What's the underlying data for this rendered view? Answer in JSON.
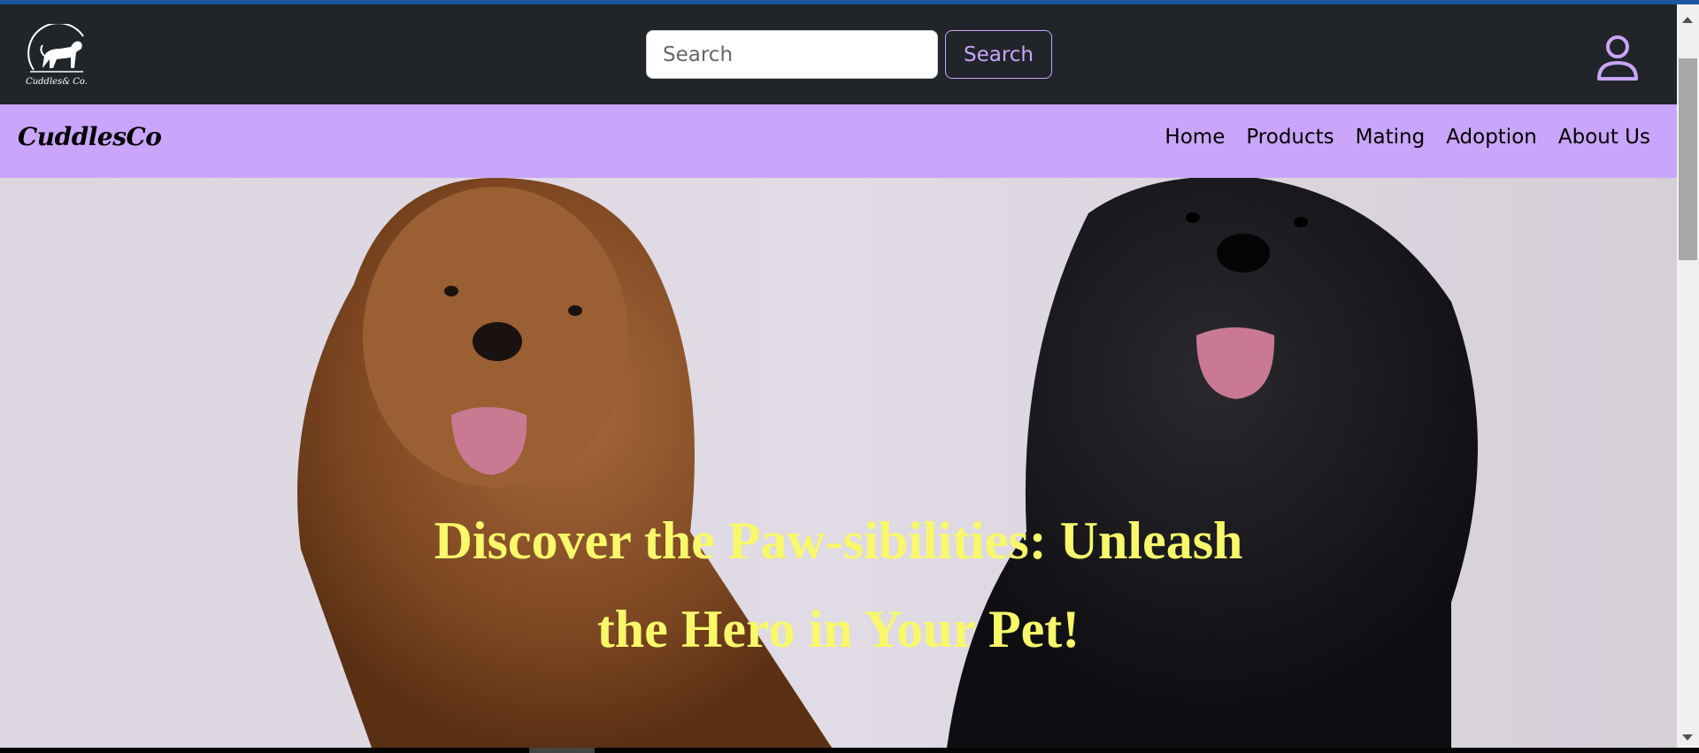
{
  "header": {
    "logo_text": "Cuddles& Co.",
    "search": {
      "placeholder": "Search",
      "value": ""
    },
    "search_button": "Search",
    "user_icon": "user-icon"
  },
  "nav": {
    "brand": "CuddlesCo",
    "links": [
      {
        "label": "Home"
      },
      {
        "label": "Products"
      },
      {
        "label": "Mating"
      },
      {
        "label": "Adoption"
      },
      {
        "label": "About Us"
      }
    ]
  },
  "hero": {
    "headline_line1": "Discover the Paw-sibilities: Unleash",
    "headline_line2": "the Hero in Your Pet!"
  },
  "colors": {
    "header_bg": "#212529",
    "nav_bg": "#c9a5fb",
    "accent": "#c9a5fb",
    "headline": "#f8f86a"
  }
}
